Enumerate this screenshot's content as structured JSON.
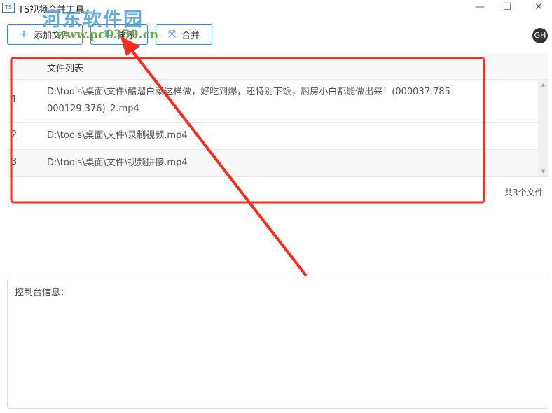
{
  "window": {
    "title": "TS视频合并工具",
    "app_icon": "TS",
    "minimize": "—",
    "maximize": "☐",
    "close": "✕"
  },
  "toolbar": {
    "add_label": "添加文件",
    "add_icon": "+",
    "sort_label": "排序",
    "sort_icon": "⇅",
    "merge_label": "合并",
    "merge_icon": "⤧",
    "github_icon": "GH"
  },
  "table": {
    "header": "文件列表",
    "rows": [
      {
        "index": "1",
        "path": "D:\\tools\\桌面\\文件\\醋溜白菜这样做，好吃到爆，还特别下饭，厨房小白都能做出来！(000037.785-000129.376)_2.mp4"
      },
      {
        "index": "2",
        "path": "D:\\tools\\桌面\\文件\\录制视频.mp4"
      },
      {
        "index": "3",
        "path": "D:\\tools\\桌面\\文件\\视频拼接.mp4"
      }
    ],
    "count": "共3个文件",
    "scroll_up": "▲",
    "scroll_down": "▼"
  },
  "console": {
    "label": "控制台信息："
  },
  "watermark": {
    "name": "河东软件园",
    "url": "www.pc0359.cn"
  },
  "colors": {
    "accent": "#2d8cf0",
    "annotation": "#ff2a1a"
  }
}
